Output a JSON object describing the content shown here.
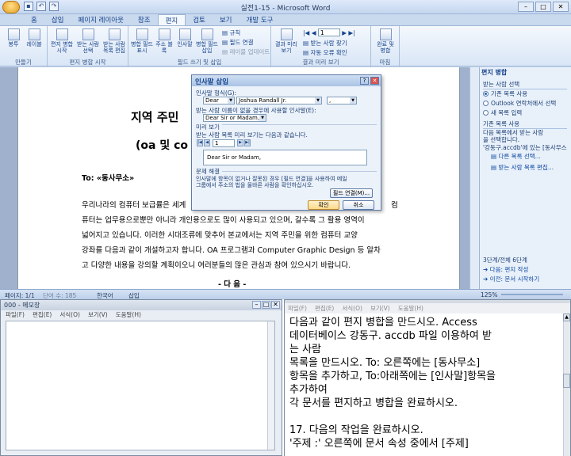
{
  "word": {
    "title": "실전1-15 - Microsoft Word",
    "tabs": [
      "홈",
      "삽입",
      "페이지 레이아웃",
      "참조",
      "편지",
      "검토",
      "보기",
      "개발 도구"
    ],
    "active_tab": "편지",
    "ribbon": {
      "groups": [
        "만들기",
        "편지 병합 시작",
        "필드 쓰기 및 삽입",
        "결과 미리 보기",
        "마침"
      ],
      "buttons": {
        "envelope": "봉투",
        "label": "레이블",
        "start_merge": "편지 병합 시작",
        "select_recipients": "받는 사람 선택",
        "edit_list": "받는 사람 목록 편집",
        "highlight": "병합 필드 표시",
        "address_block": "주소 블록",
        "greeting": "인사말",
        "insert_field": "병합 필드 삽입",
        "preview": "결과 미리 보기",
        "finish": "완료 및 병합"
      },
      "small": {
        "rules": "규칙",
        "match_fields": "필드 연결",
        "update_labels": "레이블 업데이트",
        "find_recipient": "받는 사람 찾기",
        "auto_check": "자동 오류 확인",
        "record_number": "1"
      }
    },
    "document": {
      "heading1": "지역 주민",
      "heading2": "(oa 및 co",
      "to_line": "To: «동사무소»",
      "body": [
        "우리나라의 컴퓨터 보급률은 세계",
        "퓨터는 업무용으로뿐만 아니라 개인용으로도 많이 사용되고 있으며, 갈수록 그 활용 영역이",
        "넓어지고 있습니다. 이러한 시대조류에 맞추어 본교에서는 지역 주민을 위한 컴퓨터 교양",
        "강좌를 다음과 같이 개설하고자 합니다. OA 프로그램과 Computer Graphic Design 등 알차",
        "고 다양한 내용을 강의할 계획이오니 여러분들의 많은 관심과 참여 있으시기 바랍니다."
      ],
      "body_right": "컴",
      "footer": "- 다 음 -"
    },
    "dialog": {
      "title": "인사말 삽입",
      "label_format": "인사말 형식(G):",
      "salutation": "Dear",
      "name_format": "Joshua Randall Jr.",
      "punctuation": ",",
      "label_invalid": "받는 사람 이름이 없을 경우에 사용할 인사말(E):",
      "invalid_value": "Dear Sir or Madam,",
      "preview_section": "미리 보기",
      "preview_label": "받는 사람 목록 미리 보기는 다음과 같습니다.",
      "record": "1",
      "preview_text": "Dear Sir or Madam,",
      "problem_section": "문제 해결",
      "problem_text_1": "인사말에 항목이 없거나 잘못된 경우 [필드 연결]을 사용하여 메일",
      "problem_text_2": "그룹에서 주소의 법을 올바른 사람을 확인하십시오.",
      "match_button": "필드 연결(M)...",
      "ok": "확인",
      "cancel": "취소"
    },
    "pane": {
      "title": "편지 병합",
      "section1": "받는 사람 선택",
      "options": [
        "기존 목록 사용",
        "Outlook 연락처에서 선택",
        "새 목록 입력"
      ],
      "selected_option": 0,
      "section2": "기존 목록 사용",
      "desc1": "다음 목록에서 받는 사람",
      "desc2": "을 선택합니다.",
      "source": "'강동구.accdb'에 있는 [동사무스",
      "link1": "다른 목록 선택...",
      "link2": "받는 사람 목록 편집...",
      "step": "3단계/전체 6단계",
      "next": "다음: 편지 작성",
      "prev": "이전: 문서 시작하기"
    },
    "status": {
      "page": "페이지: 1/1",
      "words": "단어 수: 185",
      "language": "한국어",
      "mode": "삽입",
      "zoom": "125%"
    }
  },
  "notepad": {
    "title": "000 - 메모장",
    "menu": [
      "파일(F)",
      "편집(E)",
      "서식(O)",
      "보기(V)",
      "도움말(H)"
    ]
  },
  "hwp": {
    "menu": [
      "파일(F)",
      "편집(E)",
      "서식(O)",
      "보기(V)",
      "도움말(H)"
    ],
    "lines": [
      "   다음과 같이 편지 병합을 만드시오. Access",
      "데이터베이스 강동구. accdb 파일 이용하여 받",
      "는 사람",
      "   목록을 만드시오. To: 오른쪽에는 [동사무소]",
      "항목을 추가하고, To:아래쪽에는 [인사말]항목을",
      "추가하여",
      "   각 문서를 편지하고 병합을 완료하시오.",
      "",
      "17. 다음의 작업을 완료하시오.",
      "    '주제 :'  오른쪽에 문서 속성 중에서 [주제]"
    ]
  }
}
